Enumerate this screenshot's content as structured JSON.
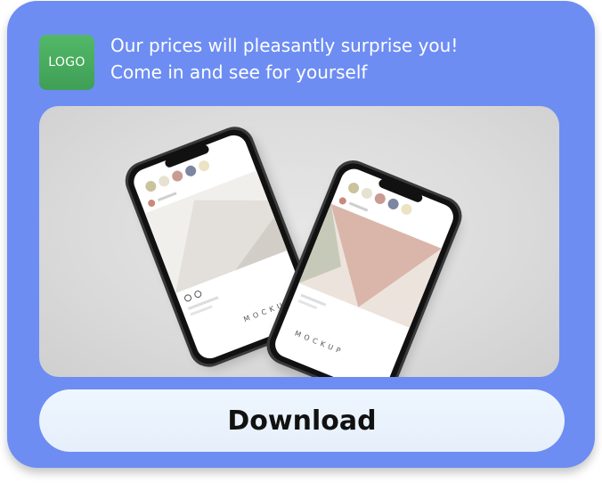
{
  "logo": {
    "label": "LOGO"
  },
  "headline": {
    "line1": "Our prices will pleasantly surprise you!",
    "line2": "Come in and see for yourself"
  },
  "banner": {
    "mockup_text_left": "MOCKUP",
    "mockup_text_right": "MOCKUP"
  },
  "download_button": {
    "label": "Download"
  },
  "colors": {
    "card_background": "#6d8df3",
    "logo_green": "#4caf61",
    "button_background": "#eaf2fc",
    "button_text": "#111111"
  }
}
